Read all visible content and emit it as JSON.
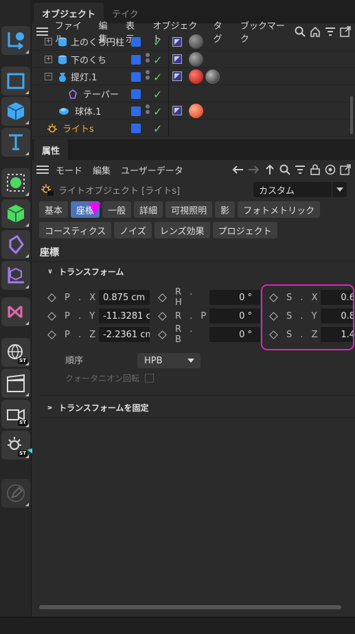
{
  "object_manager": {
    "tabs": [
      "オブジェクト",
      "テイク"
    ],
    "menu": [
      "ファイル",
      "編集",
      "表示",
      "オブジェクト",
      "タグ",
      "ブックマーク"
    ],
    "objects": [
      {
        "name": "上のくち円柱",
        "expander": "+",
        "indent": 0
      },
      {
        "name": "下のくち",
        "expander": "+",
        "indent": 0
      },
      {
        "name": "提灯.1",
        "expander": "−",
        "indent": 0
      },
      {
        "name": "テーパー",
        "expander": "",
        "indent": 1
      },
      {
        "name": "球体.1",
        "expander": "",
        "indent": 1
      },
      {
        "name": "ライトs",
        "expander": "",
        "indent": 0
      }
    ]
  },
  "attribute_manager": {
    "tabs": [
      "属性"
    ],
    "menu": [
      "モード",
      "編集",
      "ユーザーデータ"
    ],
    "object_label": "ライトオブジェクト [ライトs]",
    "preset_dropdown": "カスタム",
    "tab_pills_row1": [
      "基本",
      "座標",
      "一般",
      "詳細",
      "可視照明",
      "影",
      "フォトメトリック"
    ],
    "tab_pills_row2": [
      "コースティクス",
      "ノイズ",
      "レンズ効果",
      "プロジェクト"
    ],
    "active_tab": "座標",
    "section_title": "座標",
    "group_transform": "トランスフォーム",
    "position": {
      "x_label": "P . X",
      "x": "0.875 cm",
      "y_label": "P . Y",
      "y": "-11.3281 c",
      "z_label": "P . Z",
      "z": "-2.2361 cm"
    },
    "rotation": {
      "h_label": "R . H",
      "h": "0 °",
      "p_label": "R . P",
      "p": "0 °",
      "b_label": "R . B",
      "b": "0 °"
    },
    "scale": {
      "x_label": "S . X",
      "x": "0.6",
      "y_label": "S . Y",
      "y": "0.8",
      "z_label": "S . Z",
      "z": "1.4"
    },
    "order_label": "順序",
    "order_value": "HPB",
    "quaternion_label": "クォータニオン回転",
    "group_freeze": "トランスフォームを固定"
  },
  "colors": {
    "accent_blue": "#4a73b8",
    "highlight_magenta": "#e020c8",
    "annotation_cyan": "#1ee0f0",
    "light_orange": "#f3b03b"
  }
}
